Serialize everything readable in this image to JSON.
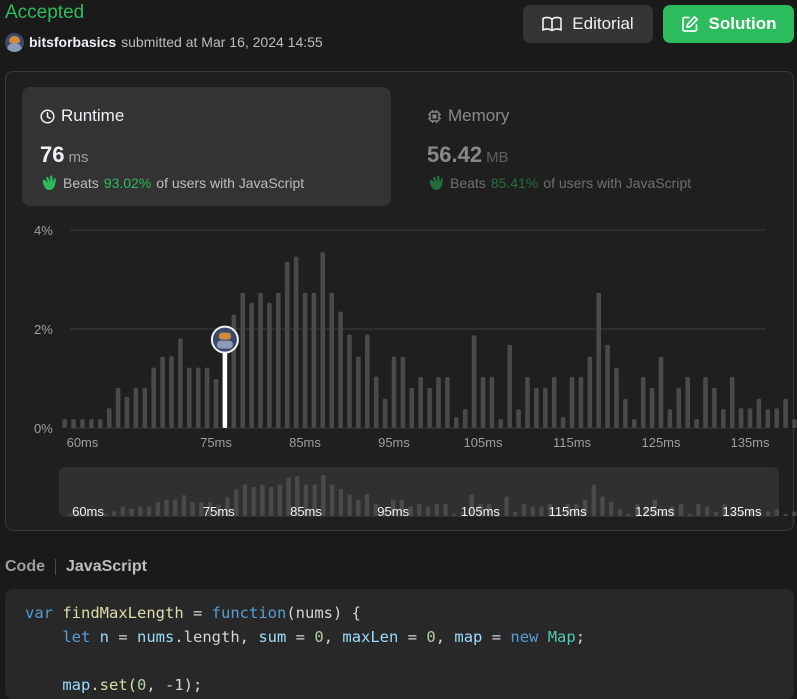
{
  "header": {
    "status": "Accepted",
    "username": "bitsforbasics",
    "submitted_text": "submitted at Mar 16, 2024 14:55",
    "editorial_label": "Editorial",
    "solution_label": "Solution"
  },
  "runtime": {
    "title": "Runtime",
    "value": "76",
    "unit": "ms",
    "beats_prefix": "Beats",
    "beats_pct": "93.02%",
    "beats_suffix": "of users with JavaScript"
  },
  "memory": {
    "title": "Memory",
    "value": "56.42",
    "unit": "MB",
    "beats_prefix": "Beats",
    "beats_pct": "85.41%",
    "beats_suffix": "of users with JavaScript"
  },
  "chart_data": {
    "type": "bar",
    "y_ticks": [
      "4%",
      "2%",
      "0%"
    ],
    "ylim": [
      0,
      4
    ],
    "x_tick_labels": [
      "60ms",
      "75ms",
      "85ms",
      "95ms",
      "105ms",
      "115ms",
      "125ms",
      "135ms"
    ],
    "x_tick_values": [
      60,
      75,
      85,
      95,
      105,
      115,
      125,
      135
    ],
    "bar_ms": [
      58,
      59,
      60,
      61,
      62,
      63,
      64,
      65,
      66,
      67,
      68,
      69,
      70,
      71,
      72,
      73,
      74,
      75,
      76,
      77,
      78,
      79,
      80,
      81,
      82,
      83,
      84,
      85,
      86,
      87,
      88,
      89,
      90,
      91,
      92,
      93,
      94,
      95,
      96,
      97,
      98,
      99,
      100,
      101,
      102,
      103,
      104,
      105,
      106,
      107,
      108,
      109,
      110,
      111,
      112,
      113,
      114,
      115,
      116,
      117,
      118,
      119,
      120,
      121,
      122,
      123,
      124,
      125,
      126,
      127,
      128,
      129,
      130,
      131,
      132,
      133,
      134,
      135,
      136,
      137,
      138,
      139,
      140,
      141,
      142,
      143
    ],
    "values": [
      0.18,
      0.18,
      0.18,
      0.18,
      0.18,
      0.4,
      0.81,
      0.63,
      0.81,
      0.81,
      1.22,
      1.44,
      1.45,
      1.81,
      1.22,
      1.22,
      1.22,
      0.99,
      1.63,
      2.29,
      2.73,
      2.53,
      2.73,
      2.53,
      2.73,
      3.36,
      3.46,
      2.73,
      2.73,
      3.55,
      2.73,
      2.35,
      1.89,
      1.44,
      1.89,
      1.04,
      0.59,
      1.44,
      1.44,
      0.81,
      1.03,
      0.81,
      1.03,
      1.03,
      0.22,
      0.38,
      1.87,
      1.03,
      1.03,
      0.18,
      1.68,
      0.38,
      1.03,
      0.81,
      0.81,
      1.03,
      0.22,
      1.03,
      1.03,
      1.44,
      2.73,
      1.68,
      1.22,
      0.59,
      0.18,
      1.03,
      0.81,
      1.44,
      0.38,
      0.81,
      1.03,
      0.18,
      1.03,
      0.81,
      0.38,
      1.03,
      0.4,
      0.4,
      0.59,
      0.38,
      0.4,
      0.59,
      0.18,
      0.38,
      0.38,
      0.18
    ],
    "highlight_ms": 76,
    "highlight_value": 1.22,
    "grid": true
  },
  "code_section": {
    "label": "Code",
    "language": "JavaScript",
    "line1": {
      "kw_var": "var",
      "fname": "findMaxLength",
      "eq": " = ",
      "kw_function": "function",
      "params": "(nums) {"
    },
    "line2": {
      "kw_let": "let",
      "n": "n",
      "a": " = ",
      "nums": "nums",
      "dot_len": ".length, ",
      "sum": "sum",
      "b": " = ",
      "zero1": "0",
      "c": ", ",
      "maxLen": "maxLen",
      "d": " = ",
      "zero2": "0",
      "e": ", ",
      "map": "map",
      "f": " = ",
      "kw_new": "new",
      "Map": "Map",
      "semi": ";"
    },
    "line3": {
      "map": "map",
      "set": ".set(",
      "zero": "0",
      "rest": ", -1);"
    }
  },
  "colors": {
    "accent_green": "#2cbb5d",
    "bar": "#4a4a4a",
    "bar_highlight": "#ffffff",
    "background": "#1a1a1a"
  }
}
